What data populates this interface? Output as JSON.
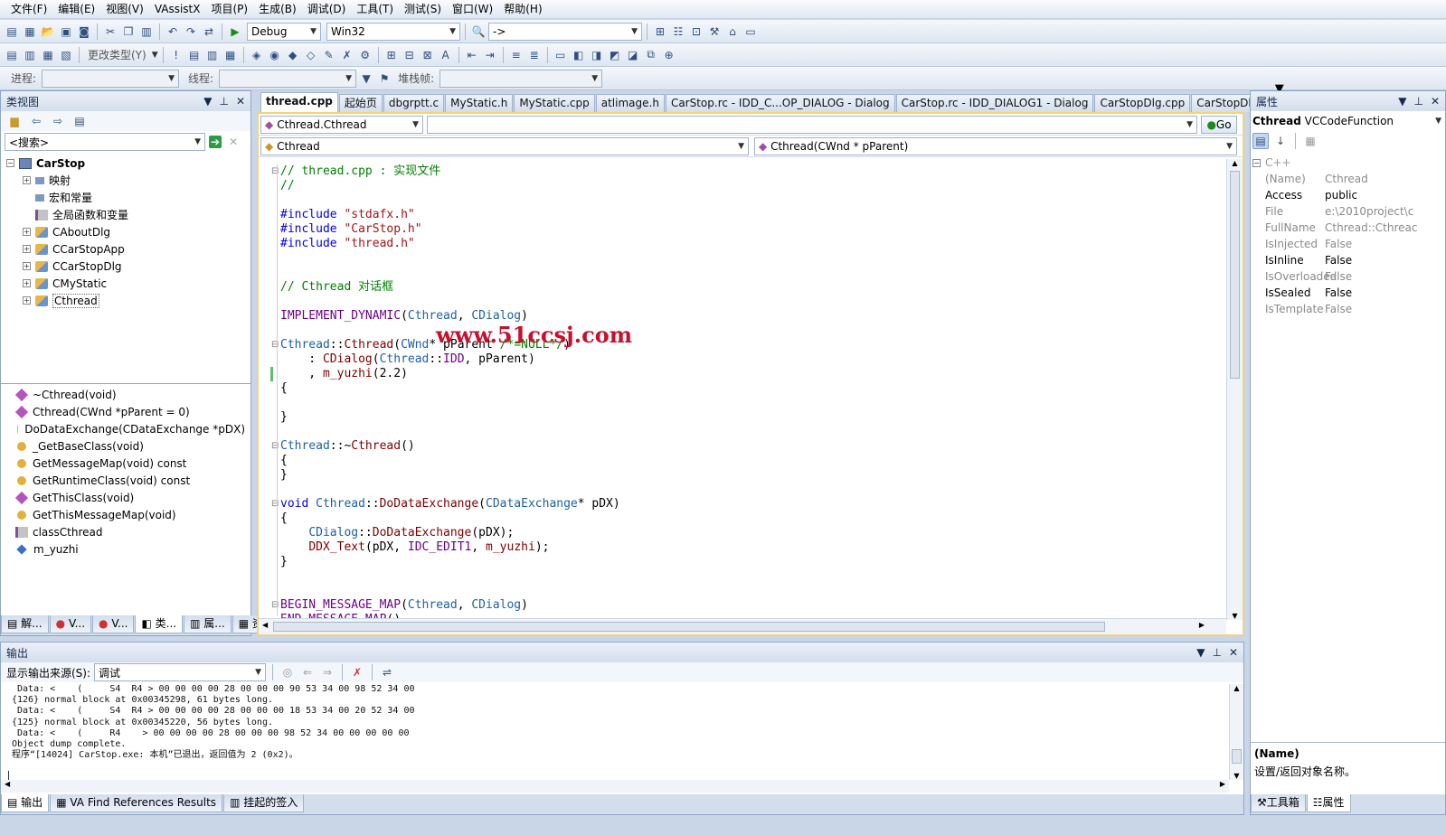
{
  "menu": [
    "文件(F)",
    "编辑(E)",
    "视图(V)",
    "VAssistX",
    "项目(P)",
    "生成(B)",
    "调试(D)",
    "工具(T)",
    "测试(S)",
    "窗口(W)",
    "帮助(H)"
  ],
  "toolbar": {
    "config": "Debug",
    "platform": "Win32",
    "find_combo": "->",
    "change_type": "更改类型(Y)"
  },
  "debug_bar": {
    "process_label": "进程:",
    "thread_label": "线程:",
    "stack_label": "堆栈帧:"
  },
  "class_view": {
    "title": "类视图",
    "search_placeholder": "<搜索>",
    "tree": {
      "root": "CarStop",
      "items": [
        "映射",
        "宏和常量",
        "全局函数和变量",
        "CAboutDlg",
        "CCarStopApp",
        "CCarStopDlg",
        "CMyStatic",
        "Cthread"
      ]
    },
    "members": [
      "~Cthread(void)",
      "Cthread(CWnd *pParent = 0)",
      "DoDataExchange(CDataExchange *pDX)",
      "_GetBaseClass(void)",
      "GetMessageMap(void) const",
      "GetRuntimeClass(void) const",
      "GetThisClass(void)",
      "GetThisMessageMap(void)",
      "classCthread",
      "m_yuzhi"
    ],
    "bottom_tabs": [
      "解...",
      "V...",
      "V...",
      "类...",
      "属...",
      "资..."
    ]
  },
  "editor": {
    "tabs": [
      "thread.cpp",
      "起始页",
      "dbgrptt.c",
      "MyStatic.h",
      "MyStatic.cpp",
      "atlimage.h",
      "CarStop.rc - IDD_C...OP_DIALOG - Dialog",
      "CarStop.rc - IDD_DIALOG1 - Dialog",
      "CarStopDlg.cpp",
      "CarStopDlg.h"
    ],
    "symbol_combo": "Cthread.Cthread",
    "go_label": "Go",
    "class_combo": "Cthread",
    "method_combo": "Cthread(CWnd * pParent)",
    "watermark": "www.51ccsj.com"
  },
  "properties": {
    "title": "属性",
    "object_name": "Cthread",
    "object_type": "VCCodeFunction",
    "category": "C++",
    "rows": [
      {
        "name": "(Name)",
        "value": "Cthread",
        "bold": false
      },
      {
        "name": "Access",
        "value": "public",
        "bold": true
      },
      {
        "name": "File",
        "value": "e:\\2010project\\c",
        "bold": false
      },
      {
        "name": "FullName",
        "value": "Cthread::Cthreac",
        "bold": false
      },
      {
        "name": "IsInjected",
        "value": "False",
        "bold": false
      },
      {
        "name": "IsInline",
        "value": "False",
        "bold": true
      },
      {
        "name": "IsOverloaded",
        "value": "False",
        "bold": false
      },
      {
        "name": "IsSealed",
        "value": "False",
        "bold": true
      },
      {
        "name": "IsTemplate",
        "value": "False",
        "bold": false
      }
    ],
    "desc_title": "(Name)",
    "desc_text": "设置/返回对象名称。",
    "bottom_tabs": [
      "工具箱",
      "属性"
    ]
  },
  "output": {
    "title": "输出",
    "source_label": "显示输出来源(S):",
    "source_value": "调试",
    "lines": [
      " Data: <    (     S4  R4 > 00 00 00 00 28 00 00 00 90 53 34 00 98 52 34 00",
      "{126} normal block at 0x00345298, 61 bytes long.",
      " Data: <    (     S4  R4 > 00 00 00 00 28 00 00 00 18 53 34 00 20 52 34 00",
      "{125} normal block at 0x00345220, 56 bytes long.",
      " Data: <    (     R4    > 00 00 00 00 28 00 00 00 98 52 34 00 00 00 00 00",
      "Object dump complete.",
      "程序“[14024] CarStop.exe: 本机”已退出，返回值为 2 (0x2)。"
    ],
    "bottom_tabs": [
      "输出",
      "VA Find References Results",
      "挂起的签入"
    ]
  }
}
